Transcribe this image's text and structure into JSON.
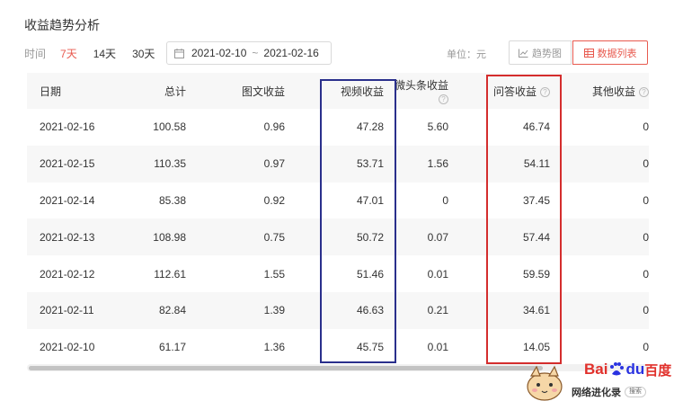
{
  "page": {
    "title": "收益趋势分析"
  },
  "filters": {
    "label": "时间",
    "ranges": [
      "7天",
      "14天",
      "30天"
    ],
    "active_range": "7天",
    "date_start": "2021-02-10",
    "date_separator": "~",
    "date_end": "2021-02-16"
  },
  "toolbar": {
    "unit": "单位：元",
    "trend_label": "趋势图",
    "list_label": "数据列表"
  },
  "table": {
    "columns": [
      "日期",
      "总计",
      "图文收益",
      "视频收益",
      "微头条收益",
      "问答收益",
      "其他收益"
    ],
    "help_columns": [
      "微头条收益",
      "问答收益",
      "其他收益"
    ],
    "rows": [
      [
        "2021-02-16",
        "100.58",
        "0.96",
        "47.28",
        "5.60",
        "46.74",
        "0"
      ],
      [
        "2021-02-15",
        "110.35",
        "0.97",
        "53.71",
        "1.56",
        "54.11",
        "0"
      ],
      [
        "2021-02-14",
        "85.38",
        "0.92",
        "47.01",
        "0",
        "37.45",
        "0"
      ],
      [
        "2021-02-13",
        "108.98",
        "0.75",
        "50.72",
        "0.07",
        "57.44",
        "0"
      ],
      [
        "2021-02-12",
        "112.61",
        "1.55",
        "51.46",
        "0.01",
        "59.59",
        "0"
      ],
      [
        "2021-02-11",
        "82.84",
        "1.39",
        "46.63",
        "0.21",
        "34.61",
        "0"
      ],
      [
        "2021-02-10",
        "61.17",
        "1.36",
        "45.75",
        "0.01",
        "14.05",
        "0"
      ]
    ]
  },
  "annotations": {
    "blue_color": "#2a2f8c",
    "red_color": "#d42d2d"
  },
  "watermark": {
    "logo_bai": "Bai",
    "logo_du": "du",
    "logo_cn": "百度",
    "caption": "网络进化录",
    "search": "搜索"
  },
  "colors": {
    "accent": "#e85a4f"
  }
}
